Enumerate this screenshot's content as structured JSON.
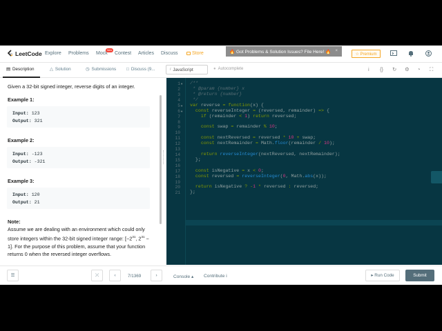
{
  "nav": {
    "logo_text": "LeetCode",
    "items": [
      "Explore",
      "Problems",
      "Mock",
      "Contest",
      "Articles",
      "Discuss"
    ],
    "mock_badge": "New",
    "store": "Store",
    "banner": "🔥 Got Problems & Solution Issues? File Here! 🔥",
    "banner_close": "×",
    "premium": "☆ Premium"
  },
  "tabs": {
    "description": "Description",
    "solution": "Solution",
    "submissions": "Submissions",
    "discuss": "Discuss (9..."
  },
  "editor_bar": {
    "language": "JavaScript",
    "autocomplete": "Autocomplete"
  },
  "problem": {
    "question": "Given a 32-bit signed integer, reverse digits of an integer.",
    "examples": [
      {
        "label": "Example 1:",
        "input_label": "Input:",
        "input": "123",
        "output_label": "Output:",
        "output": "321"
      },
      {
        "label": "Example 2:",
        "input_label": "Input:",
        "input": "-123",
        "output_label": "Output:",
        "output": "-321"
      },
      {
        "label": "Example 3:",
        "input_label": "Input:",
        "input": "120",
        "output_label": "Output:",
        "output": "21"
      }
    ],
    "note_label": "Note:",
    "note_text_1": "Assume we are dealing with an environment which could only store integers within the 32-bit signed integer range: [−2",
    "note_sup_1": "31",
    "note_text_2": ",  2",
    "note_sup_2": "31",
    "note_text_3": " − 1]. For the purpose of this problem, assume that your function returns 0 when the reversed integer overflows."
  },
  "code": {
    "line_numbers": [
      "1",
      "2",
      "3",
      "4",
      "5",
      "6",
      "7",
      "8",
      "9",
      "10",
      "11",
      "12",
      "13",
      "14",
      "15",
      "16",
      "17",
      "18",
      "19",
      "20",
      "21"
    ]
  },
  "bottom": {
    "pager": "7/1369",
    "console": "Console ▴",
    "contribute": "Contribute i",
    "run_code": "▸ Run Code",
    "submit": "Submit"
  }
}
